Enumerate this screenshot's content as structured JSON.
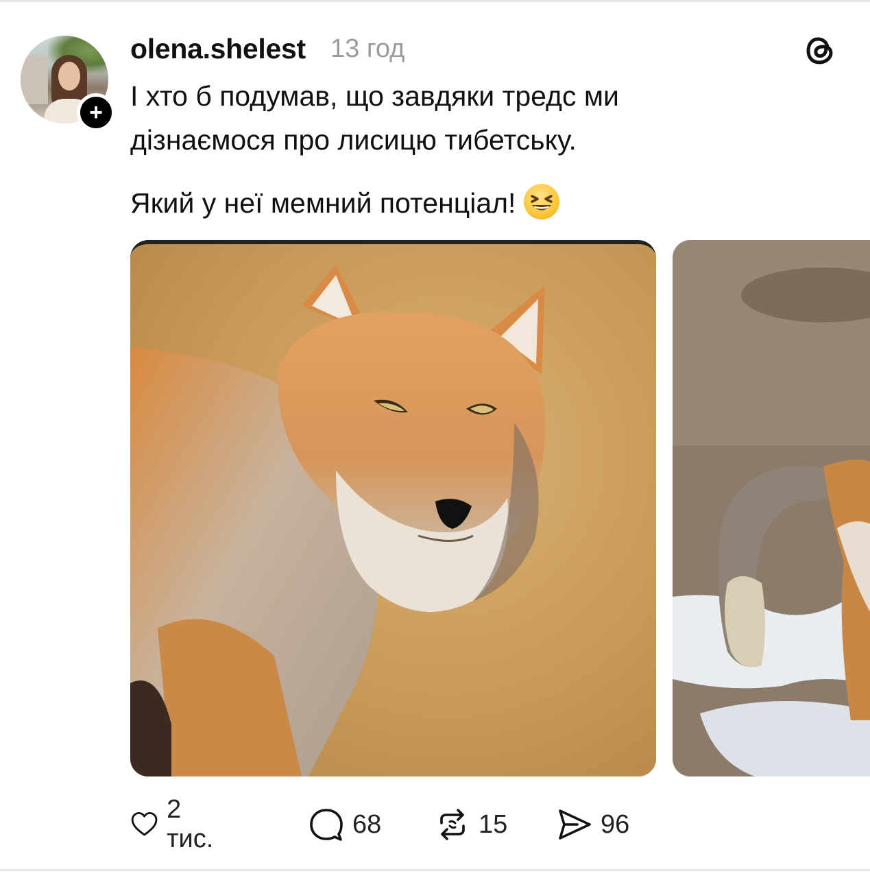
{
  "post": {
    "username": "olena.shelest",
    "timestamp": "13 год",
    "text_line1": "І хто б подумав, що завдяки тредс ми",
    "text_line2": "дізнаємося про лисицю тибетську.",
    "text_line3": "Який у неї мемний потенціал!"
  },
  "actions": {
    "likes": "2 тис.",
    "comments": "68",
    "reposts": "15",
    "shares": "96"
  },
  "icons": {
    "follow": "plus-icon",
    "app": "threads-logo-icon",
    "like": "heart-icon",
    "comment": "comment-bubble-icon",
    "repost": "repost-icon",
    "share": "send-icon",
    "emoji": "grinning-squinting-face-emoji"
  },
  "colors": {
    "text": "#111111",
    "muted": "#9a9a9a",
    "background": "#ffffff"
  }
}
